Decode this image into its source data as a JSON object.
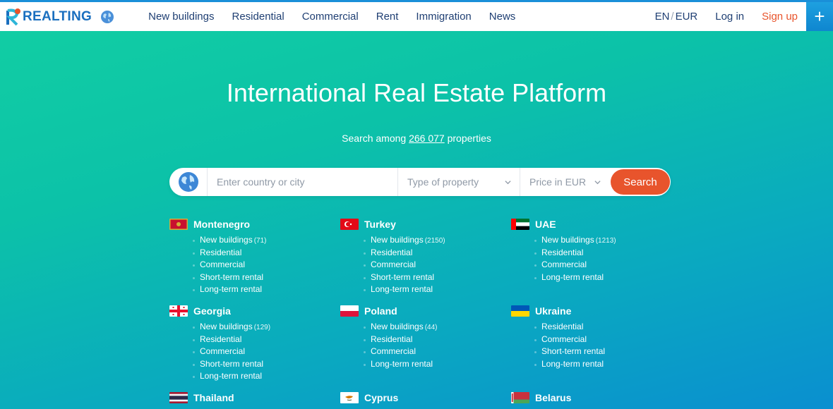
{
  "header": {
    "logo_text": "REALTING",
    "nav": [
      "New buildings",
      "Residential",
      "Commercial",
      "Rent",
      "Immigration",
      "News"
    ],
    "lang": "EN",
    "currency": "EUR",
    "login": "Log in",
    "signup": "Sign up",
    "plus": "+"
  },
  "hero": {
    "title": "International Real Estate Platform",
    "sub_prefix": "Search among",
    "count": "266 077",
    "sub_suffix": "properties"
  },
  "search": {
    "placeholder": "Enter country or city",
    "type_label": "Type of property",
    "price_label": "Price in EUR",
    "button": "Search"
  },
  "countries": [
    {
      "name": "Montenegro",
      "links": [
        {
          "label": "New buildings",
          "count": "(71)"
        },
        {
          "label": "Residential"
        },
        {
          "label": "Commercial"
        },
        {
          "label": "Short-term rental"
        },
        {
          "label": "Long-term rental"
        }
      ]
    },
    {
      "name": "Turkey",
      "links": [
        {
          "label": "New buildings",
          "count": "(2150)"
        },
        {
          "label": "Residential"
        },
        {
          "label": "Commercial"
        },
        {
          "label": "Short-term rental"
        },
        {
          "label": "Long-term rental"
        }
      ]
    },
    {
      "name": "UAE",
      "links": [
        {
          "label": "New buildings",
          "count": "(1213)"
        },
        {
          "label": "Residential"
        },
        {
          "label": "Commercial"
        },
        {
          "label": "Long-term rental"
        }
      ]
    },
    {
      "name": "Georgia",
      "links": [
        {
          "label": "New buildings",
          "count": "(129)"
        },
        {
          "label": "Residential"
        },
        {
          "label": "Commercial"
        },
        {
          "label": "Short-term rental"
        },
        {
          "label": "Long-term rental"
        }
      ]
    },
    {
      "name": "Poland",
      "links": [
        {
          "label": "New buildings",
          "count": "(44)"
        },
        {
          "label": "Residential"
        },
        {
          "label": "Commercial"
        },
        {
          "label": "Long-term rental"
        }
      ]
    },
    {
      "name": "Ukraine",
      "links": [
        {
          "label": "Residential"
        },
        {
          "label": "Commercial"
        },
        {
          "label": "Short-term rental"
        },
        {
          "label": "Long-term rental"
        }
      ]
    },
    {
      "name": "Thailand",
      "links": []
    },
    {
      "name": "Cyprus",
      "links": []
    },
    {
      "name": "Belarus",
      "links": []
    }
  ],
  "colors": {
    "accent": "#e8542c",
    "brand": "#1a6fbf",
    "nav_text": "#1f3f73"
  }
}
